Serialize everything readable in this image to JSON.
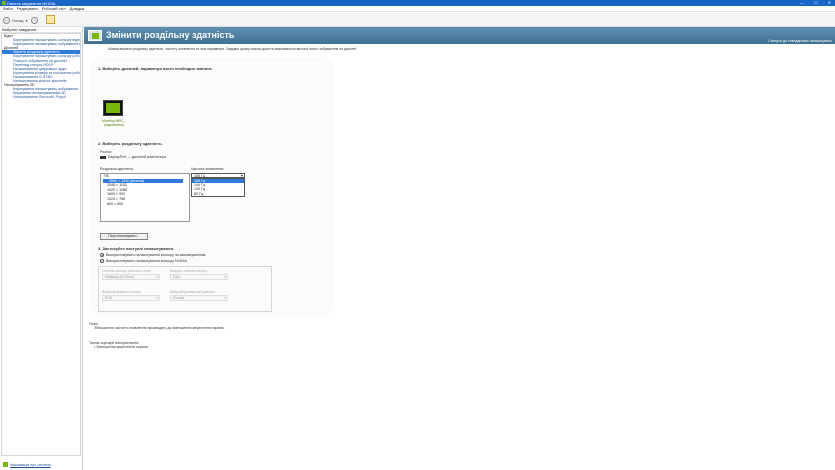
{
  "window": {
    "title": "Панель керування NVIDIA",
    "buttons": [
      "—",
      "☐",
      "✕"
    ]
  },
  "menu": [
    "Файл",
    "Редагувати",
    "Робочий стіл",
    "Довідка"
  ],
  "toolbar": {
    "back_label": "Назад"
  },
  "sidebar": {
    "header": "Вибрати завдання...",
    "tree": [
      {
        "label": "Відео",
        "kind": "cat"
      },
      {
        "label": "Коригування налаштувань кольору відео",
        "kind": "sub"
      },
      {
        "label": "Коригування налаштувань зображення відео",
        "kind": "sub"
      },
      {
        "label": "Дисплей",
        "kind": "cat"
      },
      {
        "label": "Змінити роздільну здатність",
        "kind": "sub",
        "selected": true
      },
      {
        "label": "Коригування налаштувань кольору робочого...",
        "kind": "sub"
      },
      {
        "label": "Поворот зображення на дисплеї",
        "kind": "sub"
      },
      {
        "label": "Перегляд статусу HDCP",
        "kind": "sub"
      },
      {
        "label": "Налаштування цифрового аудіо",
        "kind": "sub"
      },
      {
        "label": "Коригування розміру та положення робо...",
        "kind": "sub"
      },
      {
        "label": "Налаштування G-SYNC",
        "kind": "sub"
      },
      {
        "label": "Налаштування кількох дисплеїв",
        "kind": "sub"
      },
      {
        "label": "Налаштування 3D",
        "kind": "cat"
      },
      {
        "label": "Коригування налаштувань зображення",
        "kind": "sub"
      },
      {
        "label": "Керування налаштуваннями 3D",
        "kind": "sub"
      },
      {
        "label": "Налаштування Surround, PhysX",
        "kind": "sub"
      }
    ],
    "footer_link": "Інформація про систему"
  },
  "page": {
    "title": "Змінити роздільну здатність",
    "restore_defaults": "Скинути до стандартних налаштувань",
    "description": "Можна вказати роздільну здатність, частоту оновлення та інші параметри. Завдяки цьому можна досягти максимально високої якості зображення на дисплеї."
  },
  "step1": {
    "heading": "1. Виберіть дисплей, параметри якого необхідно змінити.",
    "monitor_label": "Монітор МРС... (підключено)"
  },
  "step2": {
    "heading": "2. Виберіть роздільну здатність.",
    "connection_label": "Роз'єм:",
    "connection_value": "DisplayPort — дисплей комп'ютера",
    "resolution_label": "Роздільна здатність:",
    "refresh_label": "Частота оновлення:",
    "resolutions": {
      "group": "ПК",
      "items": [
        {
          "label": "2560 × 1440 (власна)",
          "selected": true
        },
        {
          "label": "2048 × 1152"
        },
        {
          "label": "1920 × 1080"
        },
        {
          "label": "1600 × 900"
        },
        {
          "label": "1024 × 768"
        },
        {
          "label": "800 × 600"
        }
      ]
    },
    "refresh_selected": "165 Гц",
    "refresh_options": [
      {
        "label": "165 Гц",
        "selected": true
      },
      {
        "label": "144 Гц"
      },
      {
        "label": "120 Гц"
      },
      {
        "label": "60 Гц"
      }
    ],
    "customize_button": "Персоналізувати..."
  },
  "step3": {
    "heading": "3. Застосуйте наступні налаштування.",
    "radio1": "Використовувати налаштування кольору за замовчуванням",
    "radio2": "Використовувати налаштування кольору NVIDIA",
    "depth_label": "Глибина кольору робочого столу:",
    "depth_value": "Найвища (32-бітна)",
    "out_depth_label": "Вихідна глибина кольору:",
    "out_depth_value": "8 bpc",
    "format_label": "Вихідний формат кольору:",
    "format_value": "RGB",
    "range_label": "Вихідний динамічний діапазон:",
    "range_value": "Повний"
  },
  "notes": {
    "heading": "Опис:",
    "desc_text": "Збільшення частоти оновлення призводить до зменшення мерехтіння екрана.",
    "usage_heading": "Типові сценарії використання:",
    "usage_item": "• Зменшення мерехтіння екрана"
  }
}
